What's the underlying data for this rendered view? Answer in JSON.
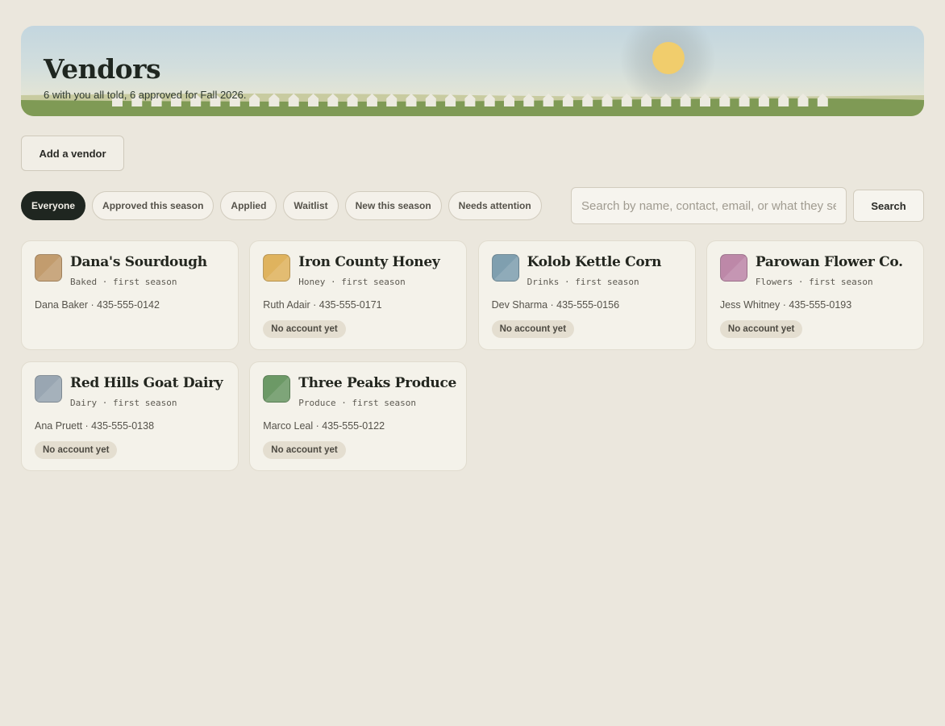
{
  "header": {
    "title": "Vendors",
    "subtitle": "6 with you all told, 6 approved for Fall 2026."
  },
  "toolbar": {
    "add_vendor_label": "Add a vendor"
  },
  "filters": [
    {
      "label": "Everyone",
      "active": true
    },
    {
      "label": "Approved this season",
      "active": false
    },
    {
      "label": "Applied",
      "active": false
    },
    {
      "label": "Waitlist",
      "active": false
    },
    {
      "label": "New this season",
      "active": false
    },
    {
      "label": "Needs attention",
      "active": false
    }
  ],
  "search": {
    "placeholder": "Search by name, contact, email, or what they sell",
    "value": "",
    "button_label": "Search"
  },
  "vendors": [
    {
      "name": "Dana's Sourdough",
      "meta": "Baked · first season",
      "contact": "Dana Baker · 435-555-0142",
      "badge": "",
      "color": "#c29c6e"
    },
    {
      "name": "Iron County Honey",
      "meta": "Honey · first season",
      "contact": "Ruth Adair · 435-555-0171",
      "badge": "No account yet",
      "color": "#dfb35e"
    },
    {
      "name": "Kolob Kettle Corn",
      "meta": "Drinks · first season",
      "contact": "Dev Sharma · 435-555-0156",
      "badge": "No account yet",
      "color": "#7f9faf"
    },
    {
      "name": "Parowan Flower Co.",
      "meta": "Flowers · first season",
      "contact": "Jess Whitney · 435-555-0193",
      "badge": "No account yet",
      "color": "#bd88a8"
    },
    {
      "name": "Red Hills Goat Dairy",
      "meta": "Dairy · first season",
      "contact": "Ana Pruett · 435-555-0138",
      "badge": "No account yet",
      "color": "#99a6b2"
    },
    {
      "name": "Three Peaks Produce",
      "meta": "Produce · first season",
      "contact": "Marco Leal · 435-555-0122",
      "badge": "No account yet",
      "color": "#6c9966"
    }
  ],
  "colors": {
    "background": "#ebe7dd",
    "active_chip": "#1f2620",
    "sun": "#f1cd6c",
    "grass": "#7f9a55"
  }
}
